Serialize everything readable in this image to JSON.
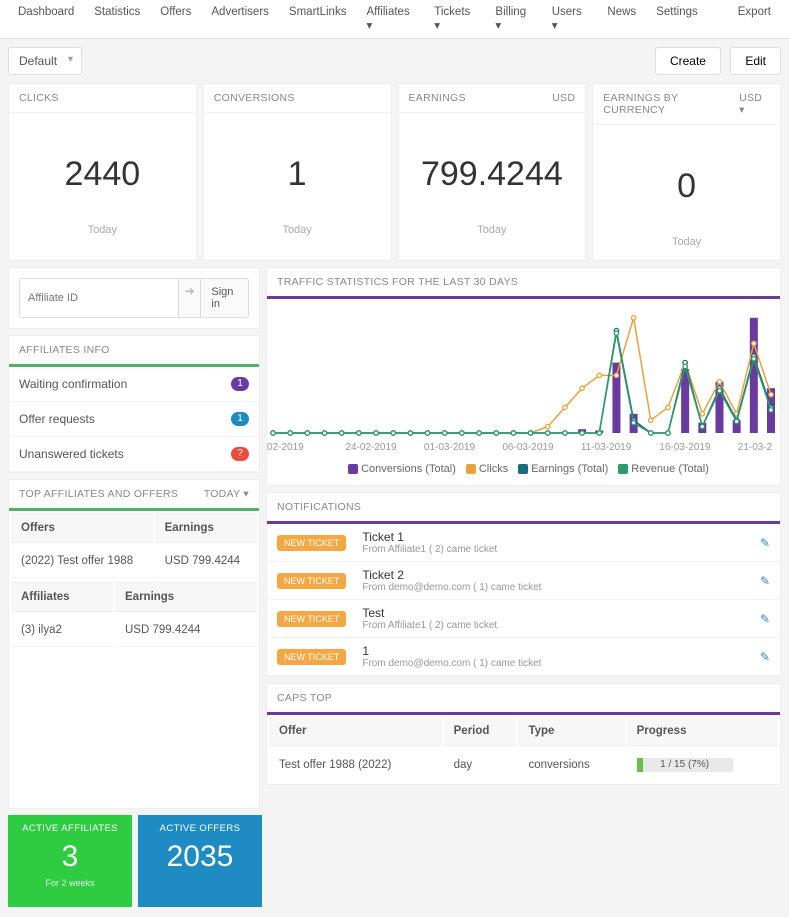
{
  "nav": [
    "Dashboard",
    "Statistics",
    "Offers",
    "Advertisers",
    "SmartLinks",
    "Affiliates ▾",
    "Tickets ▾",
    "Billing ▾",
    "Users ▾",
    "News",
    "Settings",
    "",
    "Export"
  ],
  "toolbar": {
    "view": "Default",
    "create": "Create",
    "edit": "Edit"
  },
  "kpis": [
    {
      "label": "CLICKS",
      "extra": "",
      "value": "2440",
      "foot": "Today"
    },
    {
      "label": "CONVERSIONS",
      "extra": "",
      "value": "1",
      "foot": "Today"
    },
    {
      "label": "EARNINGS",
      "extra": "USD",
      "value": "799.4244",
      "foot": "Today"
    },
    {
      "label": "EARNINGS BY CURRENCY",
      "extra": "USD ▾",
      "value": "0",
      "foot": "Today"
    }
  ],
  "signin": {
    "placeholder": "Affiliate ID",
    "arrow_icon": "➜",
    "button": "Sign in"
  },
  "affiliates_info": {
    "title": "AFFILIATES INFO",
    "rows": [
      {
        "label": "Waiting confirmation",
        "count": "1",
        "color": "purple"
      },
      {
        "label": "Offer requests",
        "count": "1",
        "color": "blue"
      },
      {
        "label": "Unanswered tickets",
        "count": "?",
        "color": "red"
      }
    ]
  },
  "top_aff": {
    "title": "TOP AFFILIATES AND OFFERS",
    "period": "TODAY ▾",
    "offers_h1": "Offers",
    "offers_h2": "Earnings",
    "offer_rows": [
      {
        "name": "(2022) Test offer 1988",
        "earn": "USD 799.4244"
      }
    ],
    "aff_h1": "Affiliates",
    "aff_h2": "Earnings",
    "aff_rows": [
      {
        "name": "(3) ilya2",
        "earn": "USD 799.4244"
      }
    ]
  },
  "chart": {
    "title": "TRAFFIC STATISTICS FOR THE LAST 30 DAYS",
    "x_labels": [
      "02-2019",
      "24-02-2019",
      "01-03-2019",
      "06-03-2019",
      "11-03-2019",
      "16-03-2019",
      "21-03-2"
    ],
    "legend": [
      {
        "name": "Conversions (Total)",
        "color": "#6b3aa0"
      },
      {
        "name": "Clicks",
        "color": "#e8a23e"
      },
      {
        "name": "Earnings (Total)",
        "color": "#1c6d7a"
      },
      {
        "name": "Revenue (Total)",
        "color": "#2c9a6a"
      }
    ]
  },
  "chart_data": {
    "type": "line",
    "x": [
      0,
      1,
      2,
      3,
      4,
      5,
      6,
      7,
      8,
      9,
      10,
      11,
      12,
      13,
      14,
      15,
      16,
      17,
      18,
      19,
      20,
      21,
      22,
      23,
      24,
      25,
      26,
      27,
      28,
      29
    ],
    "series": [
      {
        "name": "Conversions (Total)",
        "type": "bar",
        "color": "#6b3aa0",
        "values": [
          0,
          0,
          0,
          0,
          0,
          0,
          0,
          0,
          0,
          0,
          0,
          0,
          0,
          0,
          0,
          0,
          0,
          0,
          3,
          2,
          55,
          15,
          0,
          0,
          50,
          8,
          40,
          10,
          90,
          35
        ]
      },
      {
        "name": "Clicks",
        "color": "#e8a23e",
        "values": [
          0,
          0,
          0,
          0,
          0,
          0,
          0,
          0,
          0,
          0,
          0,
          0,
          0,
          0,
          0,
          0,
          5,
          20,
          35,
          45,
          45,
          90,
          10,
          20,
          55,
          15,
          40,
          15,
          70,
          30
        ]
      },
      {
        "name": "Earnings (Total)",
        "color": "#1c6d7a",
        "values": [
          0,
          0,
          0,
          0,
          0,
          0,
          0,
          0,
          0,
          0,
          0,
          0,
          0,
          0,
          0,
          0,
          0,
          0,
          0,
          0,
          80,
          10,
          0,
          0,
          55,
          5,
          35,
          10,
          60,
          20
        ]
      },
      {
        "name": "Revenue (Total)",
        "color": "#2c9a6a",
        "values": [
          0,
          0,
          0,
          0,
          0,
          0,
          0,
          0,
          0,
          0,
          0,
          0,
          0,
          0,
          0,
          0,
          0,
          0,
          0,
          0,
          78,
          8,
          0,
          0,
          52,
          5,
          33,
          9,
          58,
          18
        ]
      }
    ],
    "ylim": [
      0,
      100
    ]
  },
  "notifications": {
    "title": "NOTIFICATIONS",
    "pill": "NEW TICKET",
    "edit_icon": "✎",
    "items": [
      {
        "title": "Ticket 1",
        "sub": "From Affiliate1 ( 2) came ticket"
      },
      {
        "title": "Ticket 2",
        "sub": "From demo@demo.com ( 1) came ticket"
      },
      {
        "title": "Test",
        "sub": "From Affiliate1 ( 2) came ticket"
      },
      {
        "title": "1",
        "sub": "From demo@demo.com ( 1) came ticket"
      }
    ]
  },
  "caps": {
    "title": "CAPS TOP",
    "headers": [
      "Offer",
      "Period",
      "Type",
      "Progress"
    ],
    "row": {
      "offer": "Test offer 1988 (2022)",
      "period": "day",
      "type": "conversions",
      "progress_label": "1 / 15 (7%)",
      "progress_pct": 7
    }
  },
  "tiles": {
    "active_aff": {
      "title": "ACTIVE AFFILIATES",
      "value": "3",
      "sub": "For 2 weeks"
    },
    "active_off": {
      "title": "ACTIVE OFFERS",
      "value": "2035",
      "sub": ""
    }
  }
}
